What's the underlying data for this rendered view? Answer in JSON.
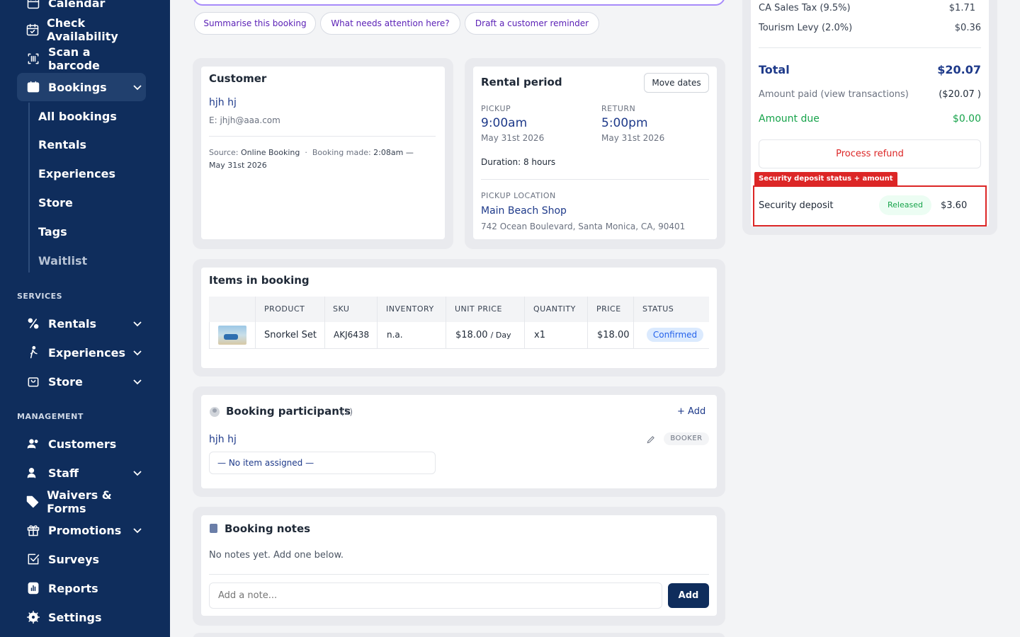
{
  "sidebar": {
    "items": [
      {
        "label": "Calendar"
      },
      {
        "label": "Check Availability"
      },
      {
        "label": "Scan a barcode"
      },
      {
        "label": "Bookings"
      }
    ],
    "bookings_sub": [
      "All bookings",
      "Rentals",
      "Experiences",
      "Store",
      "Tags",
      "Waitlist"
    ],
    "services_label": "SERVICES",
    "services": [
      {
        "label": "Rentals"
      },
      {
        "label": "Experiences"
      },
      {
        "label": "Store"
      }
    ],
    "management_label": "MANAGEMENT",
    "management": [
      {
        "label": "Customers"
      },
      {
        "label": "Staff"
      },
      {
        "label": "Waivers & Forms"
      },
      {
        "label": "Promotions"
      },
      {
        "label": "Surveys"
      },
      {
        "label": "Reports"
      },
      {
        "label": "Settings"
      }
    ]
  },
  "chips": [
    "Summarise this booking",
    "What needs attention here?",
    "Draft a customer reminder"
  ],
  "customer": {
    "title": "Customer",
    "name": "hjh hj",
    "email": "E: jhjh@aaa.com",
    "source_label": "Source:",
    "source": "Online Booking",
    "made_label": "Booking made:",
    "made_time": "2:08am —",
    "made_date": "May 31st 2026"
  },
  "rental": {
    "title": "Rental period",
    "move_dates": "Move dates",
    "pickup_label": "PICKUP",
    "pickup_time": "9:00am",
    "pickup_date": "May 31st 2026",
    "return_label": "RETURN",
    "return_time": "5:00pm",
    "return_date": "May 31st 2026",
    "duration": "Duration: 8 hours",
    "location_label": "PICKUP LOCATION",
    "location_name": "Main Beach Shop",
    "location_address": "742 Ocean Boulevard, Santa Monica, CA, 90401"
  },
  "items": {
    "title": "Items in booking",
    "headers": [
      "PRODUCT",
      "SKU",
      "INVENTORY",
      "UNIT PRICE",
      "QUANTITY",
      "PRICE",
      "STATUS"
    ],
    "rows": [
      {
        "product": "Snorkel Set",
        "sku": "AKJ6438",
        "inventory": "n.a.",
        "unit_price": "$18.00",
        "unit": "/ Day",
        "quantity": "x1",
        "price": "$18.00",
        "status": "Confirmed"
      }
    ]
  },
  "participants": {
    "title": "Booking participants",
    "count": "(1)",
    "add": "+ Add",
    "name": "hjh hj",
    "role": "BOOKER",
    "item_assigned": "— No item assigned —"
  },
  "notes": {
    "title": "Booking notes",
    "empty": "No notes yet. Add one below.",
    "placeholder": "Add a note...",
    "add_button": "Add"
  },
  "summary": {
    "taxes": [
      {
        "label": "CA Sales Tax (9.5%)",
        "value": "$1.71"
      },
      {
        "label": "Tourism Levy (2.0%)",
        "value": "$0.36"
      }
    ],
    "total_label": "Total",
    "total_value": "$20.07",
    "paid_label": "Amount paid (view transactions)",
    "paid_value": "($20.07 )",
    "due_label": "Amount due",
    "due_value": "$0.00",
    "refund_button": "Process refund",
    "deposit_tag": "Security deposit status + amount",
    "deposit_label": "Security deposit",
    "deposit_status": "Released",
    "deposit_value": "$3.60"
  },
  "colors": {
    "sidebar": "#0f2d5c",
    "accent_purple": "#5b21b6",
    "green": "#16a34a",
    "red": "#dc2626",
    "navy_button": "#0f2d5c"
  }
}
